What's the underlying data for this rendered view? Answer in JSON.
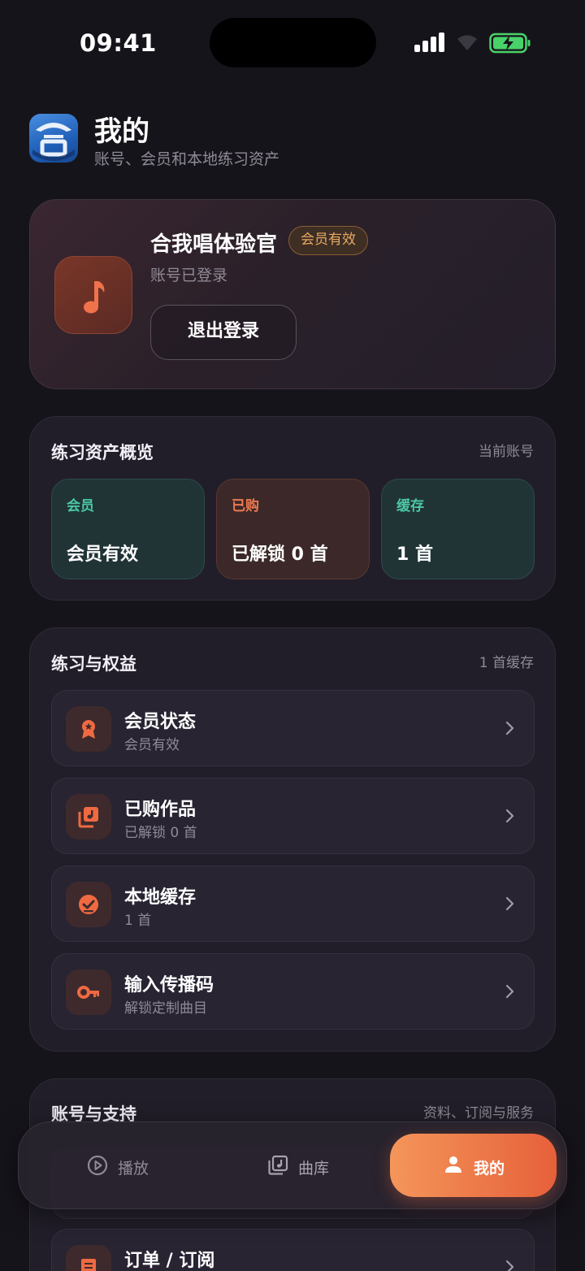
{
  "status_bar": {
    "time": "09:41"
  },
  "header": {
    "title": "我的",
    "subtitle": "账号、会员和本地练习资产",
    "logo_icon": "app-logo-icon"
  },
  "profile": {
    "name": "合我唱体验官",
    "badge": "会员有效",
    "login_status": "账号已登录",
    "logout_label": "退出登录",
    "avatar_icon": "music-note-icon"
  },
  "overview": {
    "title": "练习资产概览",
    "meta": "当前账号",
    "tiles": [
      {
        "label": "会员",
        "value": "会员有效"
      },
      {
        "label": "已购",
        "value": "已解锁 0 首"
      },
      {
        "label": "缓存",
        "value": "1 首"
      }
    ]
  },
  "practice": {
    "title": "练习与权益",
    "meta": "1 首缓存",
    "items": [
      {
        "title": "会员状态",
        "sub": "会员有效",
        "icon": "medal-icon"
      },
      {
        "title": "已购作品",
        "sub": "已解锁 0 首",
        "icon": "music-library-icon"
      },
      {
        "title": "本地缓存",
        "sub": "1 首",
        "icon": "check-circle-icon"
      },
      {
        "title": "输入传播码",
        "sub": "解锁定制曲目",
        "icon": "key-icon"
      }
    ]
  },
  "account": {
    "title": "账号与支持",
    "meta": "资料、订阅与服务",
    "items": [
      {
        "title": "订单 / 订阅",
        "icon": "receipt-icon"
      }
    ]
  },
  "nav": {
    "items": [
      {
        "label": "播放",
        "icon": "play-circle-icon"
      },
      {
        "label": "曲库",
        "icon": "music-library-icon"
      },
      {
        "label": "我的",
        "icon": "person-icon",
        "active": true
      }
    ]
  },
  "colors": {
    "accent": "#e6603a",
    "teal": "#4cc7a6",
    "gold": "#e6a964",
    "background": "#16141b"
  }
}
